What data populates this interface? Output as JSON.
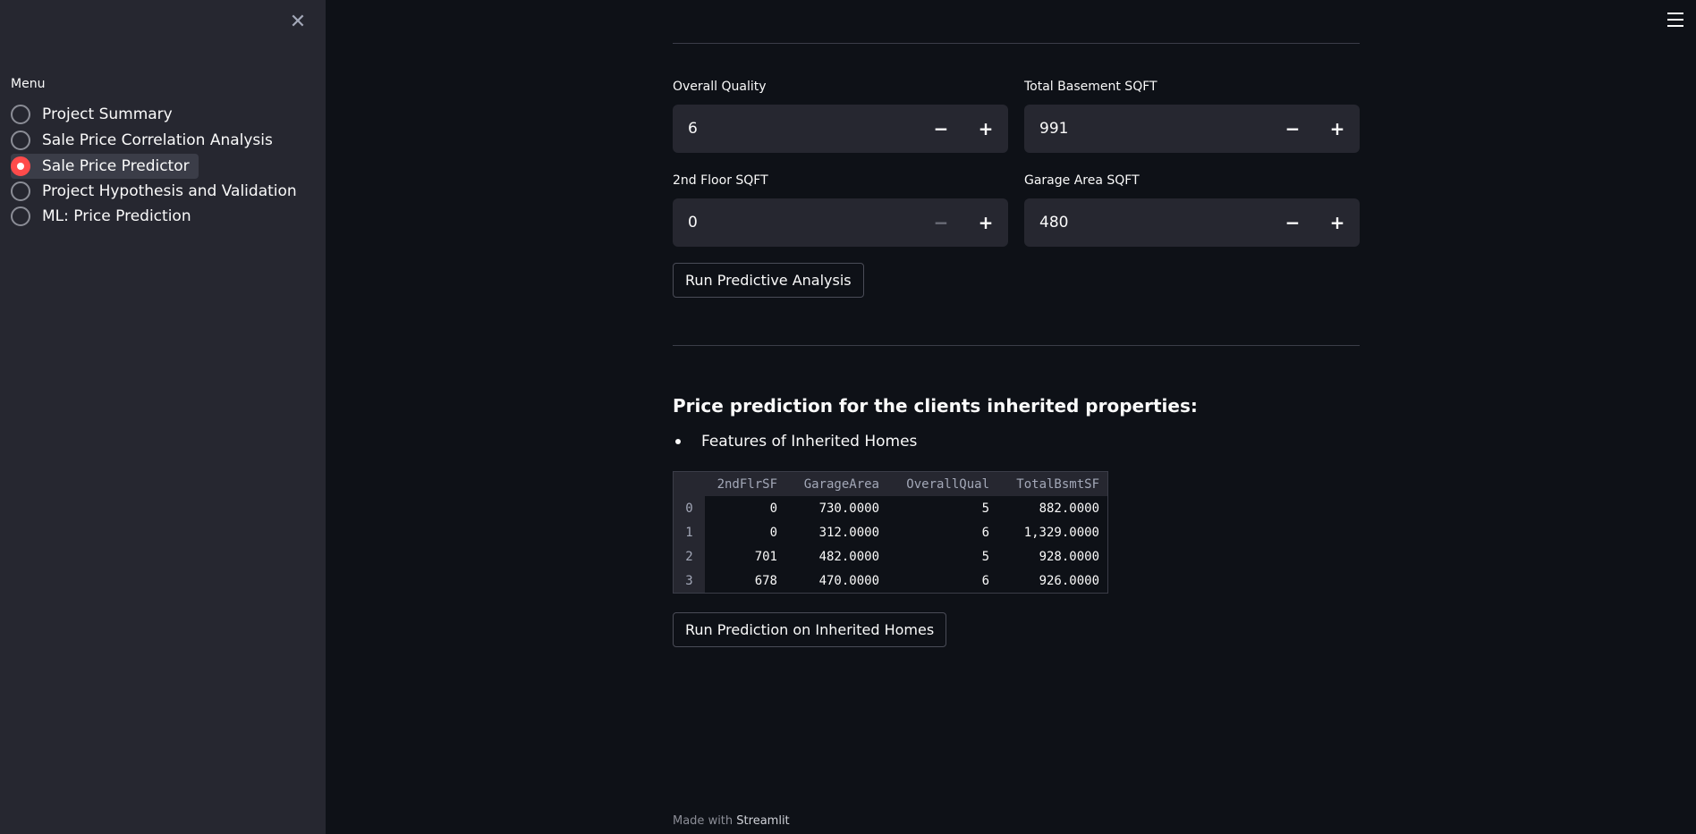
{
  "sidebar": {
    "menu_label": "Menu",
    "close_glyph": "✕",
    "items": [
      {
        "label": "Project Summary",
        "selected": false
      },
      {
        "label": "Sale Price Correlation Analysis",
        "selected": false
      },
      {
        "label": "Sale Price Predictor",
        "selected": true
      },
      {
        "label": "Project Hypothesis and Validation",
        "selected": false
      },
      {
        "label": "ML: Price Prediction",
        "selected": false
      }
    ]
  },
  "inputs": {
    "overall_quality": {
      "label": "Overall Quality",
      "value": "6"
    },
    "total_bsmt": {
      "label": "Total Basement SQFT",
      "value": "991"
    },
    "second_floor": {
      "label": "2nd Floor SQFT",
      "value": "0"
    },
    "garage_area": {
      "label": "Garage Area SQFT",
      "value": "480"
    },
    "minus": "−",
    "plus": "+"
  },
  "buttons": {
    "run_predictive": "Run Predictive Analysis",
    "run_inherited": "Run Prediction on Inherited Homes"
  },
  "section": {
    "heading": "Price prediction for the clients inherited properties:",
    "bullet": "Features of Inherited Homes"
  },
  "table": {
    "columns": [
      "",
      "2ndFlrSF",
      "GarageArea",
      "OverallQual",
      "TotalBsmtSF"
    ],
    "rows": [
      {
        "index": "0",
        "cells": [
          "0",
          "730.0000",
          "5",
          "882.0000"
        ]
      },
      {
        "index": "1",
        "cells": [
          "0",
          "312.0000",
          "6",
          "1,329.0000"
        ]
      },
      {
        "index": "2",
        "cells": [
          "701",
          "482.0000",
          "5",
          "928.0000"
        ]
      },
      {
        "index": "3",
        "cells": [
          "678",
          "470.0000",
          "6",
          "926.0000"
        ]
      }
    ]
  },
  "footer": {
    "prefix": "Made with",
    "brand": "Streamlit"
  },
  "colors": {
    "accent": "#ff4b4b",
    "background": "#0e1117",
    "sidebar": "#262730"
  },
  "icons": {
    "close": "close-icon",
    "menu": "hamburger-icon"
  }
}
